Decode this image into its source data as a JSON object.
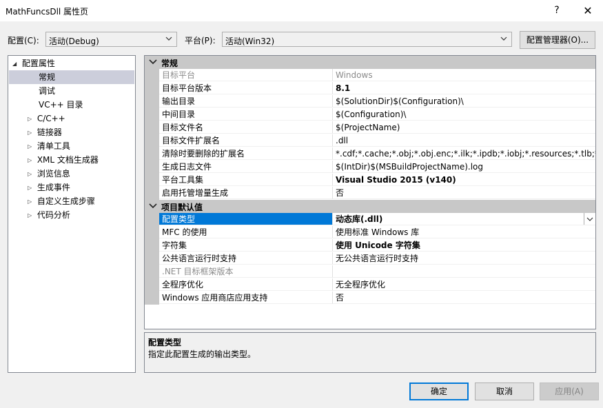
{
  "window": {
    "title": "MathFuncsDll 属性页",
    "help_label": "?",
    "close_label": "✕"
  },
  "top": {
    "config_label": "配置(C):",
    "config_value": "活动(Debug)",
    "platform_label": "平台(P):",
    "platform_value": "活动(Win32)",
    "config_manager_label": "配置管理器(O)..."
  },
  "tree": {
    "root": "配置属性",
    "items": [
      {
        "label": "常规",
        "expandable": false,
        "selected": true
      },
      {
        "label": "调试",
        "expandable": false
      },
      {
        "label": "VC++ 目录",
        "expandable": false
      },
      {
        "label": "C/C++",
        "expandable": true
      },
      {
        "label": "链接器",
        "expandable": true
      },
      {
        "label": "清单工具",
        "expandable": true
      },
      {
        "label": "XML 文档生成器",
        "expandable": true
      },
      {
        "label": "浏览信息",
        "expandable": true
      },
      {
        "label": "生成事件",
        "expandable": true
      },
      {
        "label": "自定义生成步骤",
        "expandable": true
      },
      {
        "label": "代码分析",
        "expandable": true
      }
    ]
  },
  "grid": {
    "categories": [
      {
        "title": "常规",
        "rows": [
          {
            "name": "目标平台",
            "value": "Windows",
            "disabled": true
          },
          {
            "name": "目标平台版本",
            "value": "8.1",
            "bold": true
          },
          {
            "name": "输出目录",
            "value": "$(SolutionDir)$(Configuration)\\"
          },
          {
            "name": "中间目录",
            "value": "$(Configuration)\\"
          },
          {
            "name": "目标文件名",
            "value": "$(ProjectName)"
          },
          {
            "name": "目标文件扩展名",
            "value": ".dll"
          },
          {
            "name": "清除时要删除的扩展名",
            "value": "*.cdf;*.cache;*.obj;*.obj.enc;*.ilk;*.ipdb;*.iobj;*.resources;*.tlb;*.tli;*.t"
          },
          {
            "name": "生成日志文件",
            "value": "$(IntDir)$(MSBuildProjectName).log"
          },
          {
            "name": "平台工具集",
            "value": "Visual Studio 2015 (v140)",
            "bold": true
          },
          {
            "name": "启用托管增量生成",
            "value": "否"
          }
        ]
      },
      {
        "title": "项目默认值",
        "rows": [
          {
            "name": "配置类型",
            "value": "动态库(.dll)",
            "bold": true,
            "selected": true
          },
          {
            "name": "MFC 的使用",
            "value": "使用标准 Windows 库"
          },
          {
            "name": "字符集",
            "value": "使用 Unicode 字符集",
            "bold": true
          },
          {
            "name": "公共语言运行时支持",
            "value": "无公共语言运行时支持"
          },
          {
            "name": ".NET 目标框架版本",
            "value": "",
            "disabled": true
          },
          {
            "name": "全程序优化",
            "value": "无全程序优化"
          },
          {
            "name": "Windows 应用商店应用支持",
            "value": "否"
          }
        ]
      }
    ]
  },
  "description": {
    "title": "配置类型",
    "text": "指定此配置生成的输出类型。"
  },
  "buttons": {
    "ok": "确定",
    "cancel": "取消",
    "apply": "应用(A)"
  }
}
